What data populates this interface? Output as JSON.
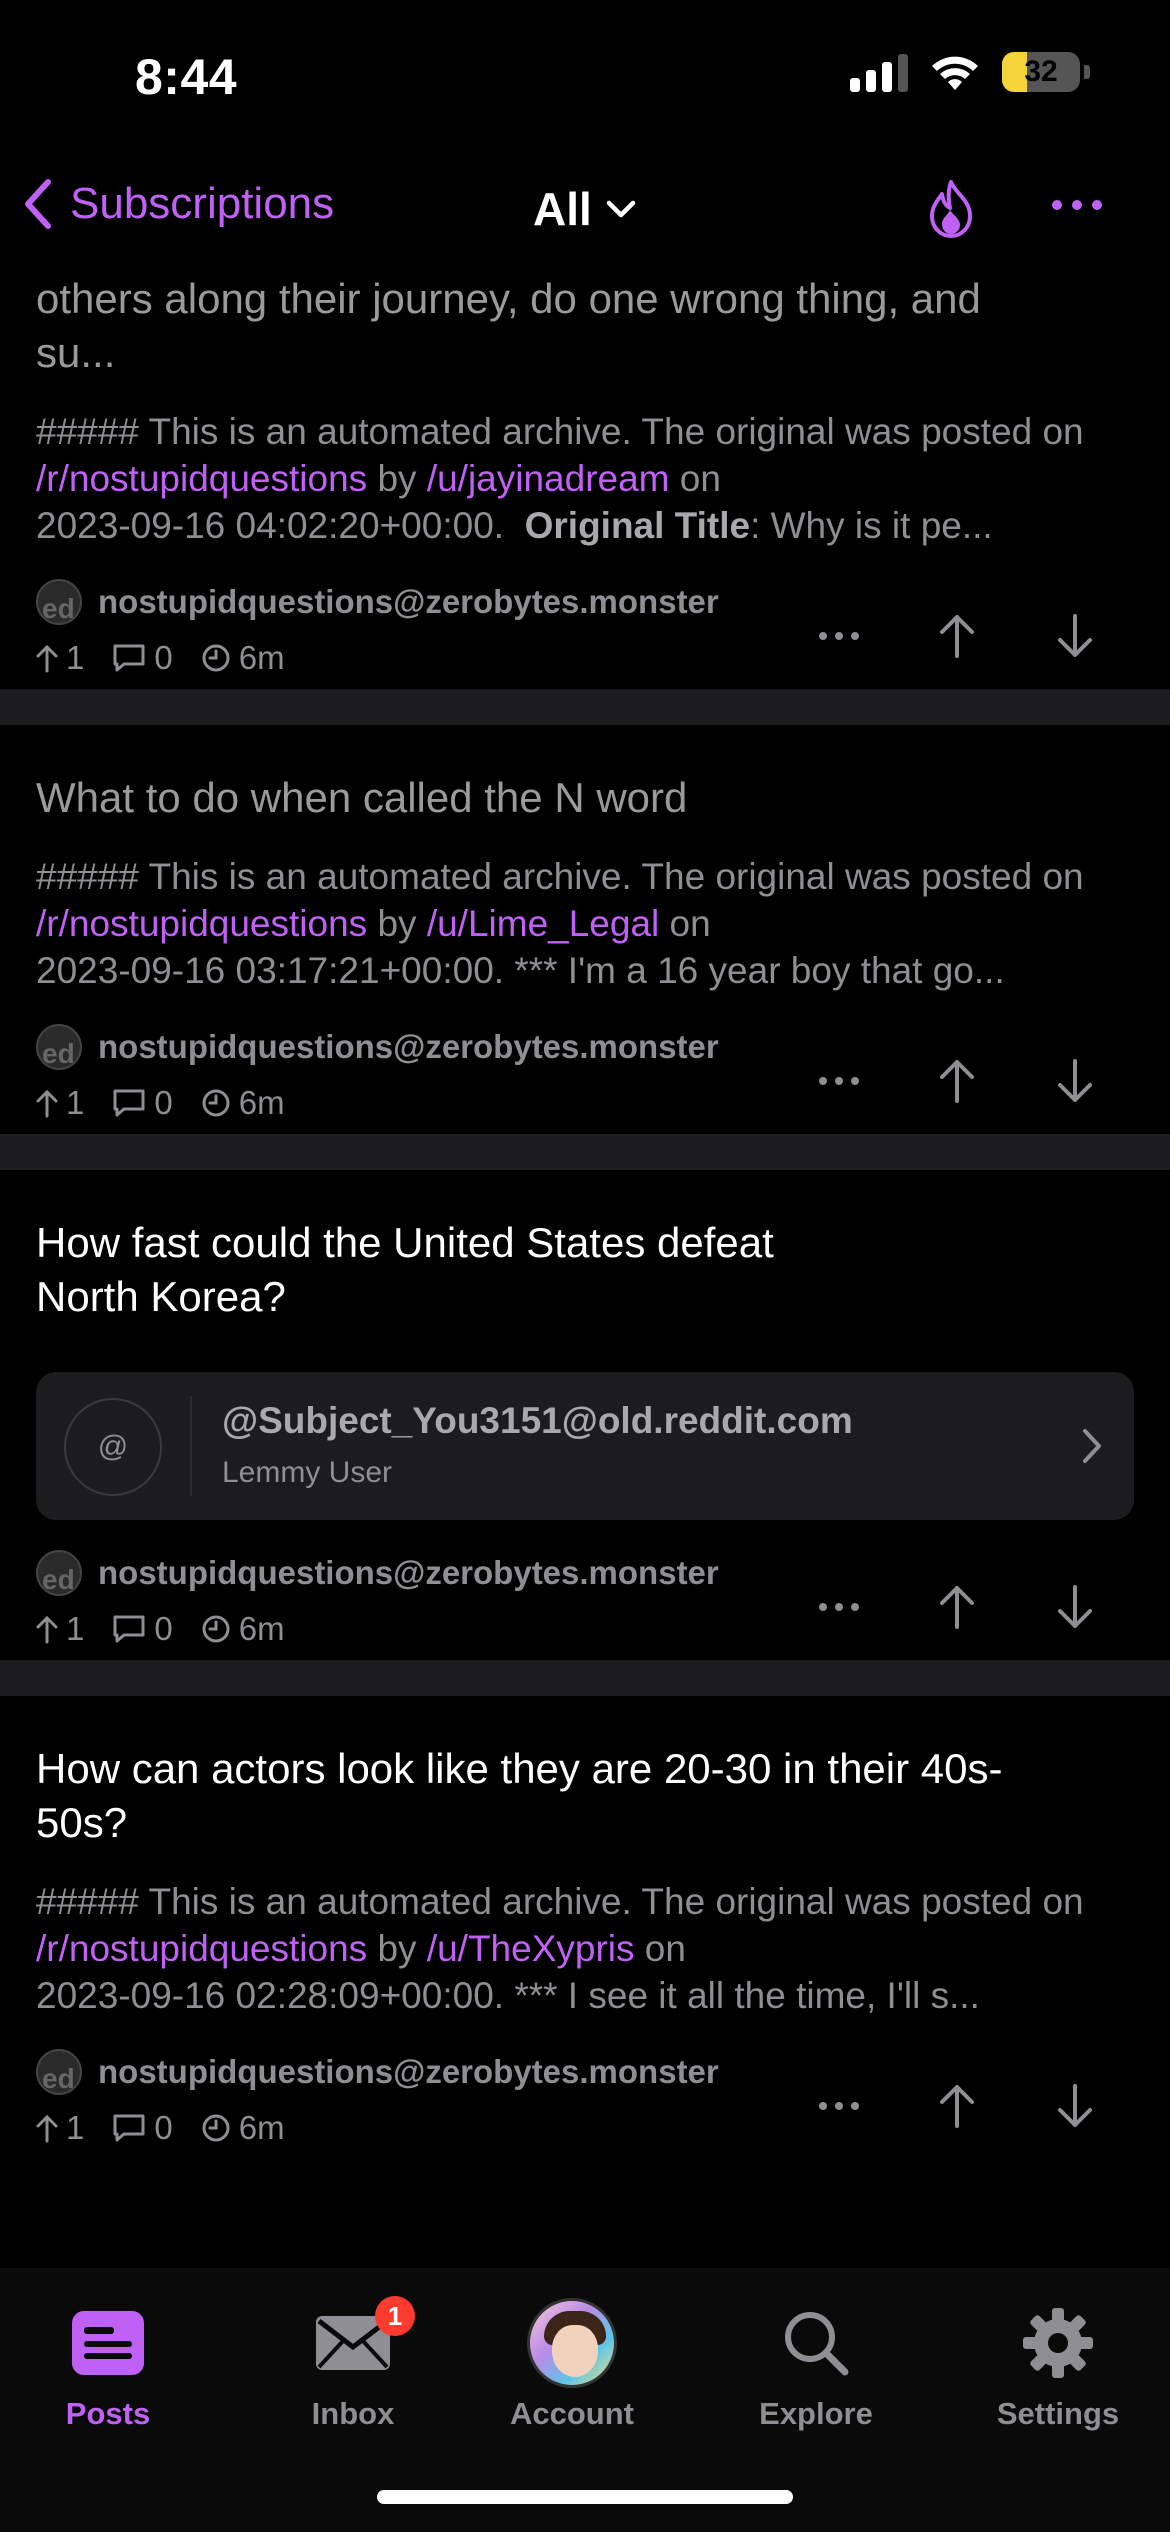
{
  "status": {
    "time": "8:44",
    "battery": "32",
    "battery_level": 0.32
  },
  "nav": {
    "back_label": "Subscriptions",
    "title": "All"
  },
  "posts": [
    {
      "title": "others along their journey, do one wrong thing, and su...",
      "body_prefix": "##### This is an automated archive. The original was posted on ",
      "subreddit": "/r/nostupidquestions",
      "by": " by ",
      "user": "/u/jayinadream",
      "on": " on ",
      "date": "2023-09-16 04:02:20+00:00.",
      "bold": "Original Title",
      "body_suffix": ": Why is it pe...",
      "community": "nostupidquestions@zerobytes.monster",
      "upvotes": "1",
      "comments": "0",
      "age": "6m"
    },
    {
      "title": "What to do when called the N word",
      "body_prefix": "##### This is an automated archive. The original was posted on ",
      "subreddit": "/r/nostupidquestions",
      "by": " by ",
      "user": "/u/Lime_Legal",
      "on": " on ",
      "date": "2023-09-16 03:17:21+00:00.",
      "body_suffix": " *** I'm a 16 year boy that go...",
      "community": "nostupidquestions@zerobytes.monster",
      "upvotes": "1",
      "comments": "0",
      "age": "6m"
    },
    {
      "title": "How fast could the United States defeat North Korea?",
      "card_name": "@Subject_You3151@old.reddit.com",
      "card_sub": "Lemmy User",
      "card_symbol": "@",
      "community": "nostupidquestions@zerobytes.monster",
      "upvotes": "1",
      "comments": "0",
      "age": "6m"
    },
    {
      "title": "How can actors look like they are 20-30 in their 40s-50s?",
      "body_prefix": "##### This is an automated archive. The original was posted on ",
      "subreddit": "/r/nostupidquestions",
      "by": " by ",
      "user": "/u/TheXypris",
      "on": " on ",
      "date": "2023-09-16 02:28:09+00:00.",
      "body_suffix": " *** I see it all the time, I'll s...",
      "community": "nostupidquestions@zerobytes.monster",
      "upvotes": "1",
      "comments": "0",
      "age": "6m"
    }
  ],
  "tabs": [
    {
      "label": "Posts",
      "icon": "posts-icon"
    },
    {
      "label": "Inbox",
      "icon": "inbox-icon",
      "badge": "1"
    },
    {
      "label": "Account",
      "icon": "account-avatar"
    },
    {
      "label": "Explore",
      "icon": "search-icon"
    },
    {
      "label": "Settings",
      "icon": "gear-icon"
    }
  ],
  "colors": {
    "accent": "#c061f5",
    "muted": "#8e8e93",
    "badge": "#ff3b30"
  }
}
